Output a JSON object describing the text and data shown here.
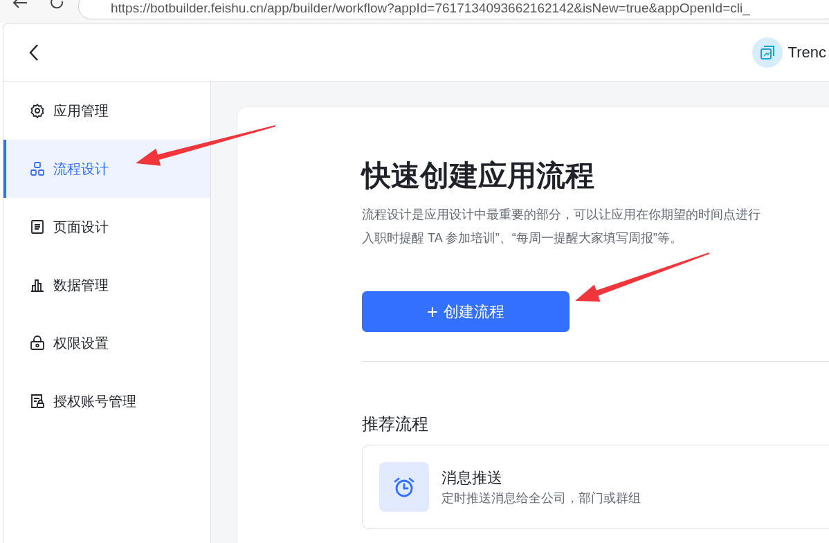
{
  "browser": {
    "url": "https://botbuilder.feishu.cn/app/builder/workflow?appId=7617134093662162142&isNew=true&appOpenId=cli_"
  },
  "header": {
    "app_name": "Trenc"
  },
  "sidebar": {
    "items": [
      {
        "label": "应用管理",
        "selected": false
      },
      {
        "label": "流程设计",
        "selected": true
      },
      {
        "label": "页面设计",
        "selected": false
      },
      {
        "label": "数据管理",
        "selected": false
      },
      {
        "label": "权限设置",
        "selected": false
      },
      {
        "label": "授权账号管理",
        "selected": false
      }
    ]
  },
  "main": {
    "title": "快速创建应用流程",
    "description_lines": [
      "流程设计是应用设计中最重要的部分，可以让应用在你期望的时间点进行",
      "入职时提醒 TA 参加培训”、“每周一提醒大家填写周报”等。"
    ],
    "create_button": {
      "label": "创建流程",
      "icon": "+"
    },
    "recommended": {
      "heading": "推荐流程",
      "items": [
        {
          "title": "消息推送",
          "subtitle": "定时推送消息给全公司，部门或群组"
        }
      ]
    }
  },
  "annotations": [
    {
      "kind": "arrow"
    },
    {
      "kind": "arrow"
    }
  ]
}
